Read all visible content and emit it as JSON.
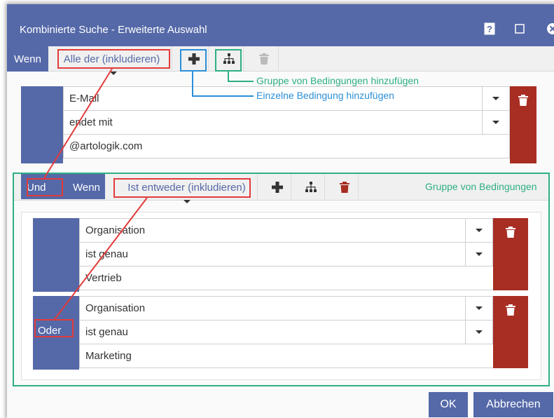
{
  "window": {
    "title": "Kombinierte Suche - Erweiterte Auswahl",
    "icons": [
      "help-icon",
      "maximize-icon",
      "close-icon"
    ]
  },
  "toolbar": {
    "wenn_label": "Wenn",
    "combinator": "Alle der (inkludieren)",
    "icons": [
      "plus-icon",
      "sitemap-icon",
      "trash-icon"
    ]
  },
  "condition1": {
    "field": "E-Mail",
    "operator": "endet mit",
    "value": "@artologik.com"
  },
  "group": {
    "und_label": "Und",
    "wenn_label": "Wenn",
    "combinator": "Ist entweder (inkludieren)",
    "title": "Gruppe von Bedingungen",
    "conditions": [
      {
        "field": "Organisation",
        "operator": "ist genau",
        "value": "Vertrieb"
      },
      {
        "or_label": "Oder",
        "field": "Organisation",
        "operator": "ist genau",
        "value": "Marketing"
      }
    ]
  },
  "annotations": {
    "add_group": "Gruppe von Bedingungen hinzufügen",
    "add_single": "Einzelne Bedingung hinzufügen"
  },
  "footer": {
    "ok_label": "OK",
    "cancel_label": "Abbrechen"
  },
  "colors": {
    "primary": "#5569a8",
    "danger": "#a82d22",
    "annotation_red": "#e23b3b",
    "annotation_blue": "#2b8fd8",
    "annotation_green": "#2eaf86"
  }
}
